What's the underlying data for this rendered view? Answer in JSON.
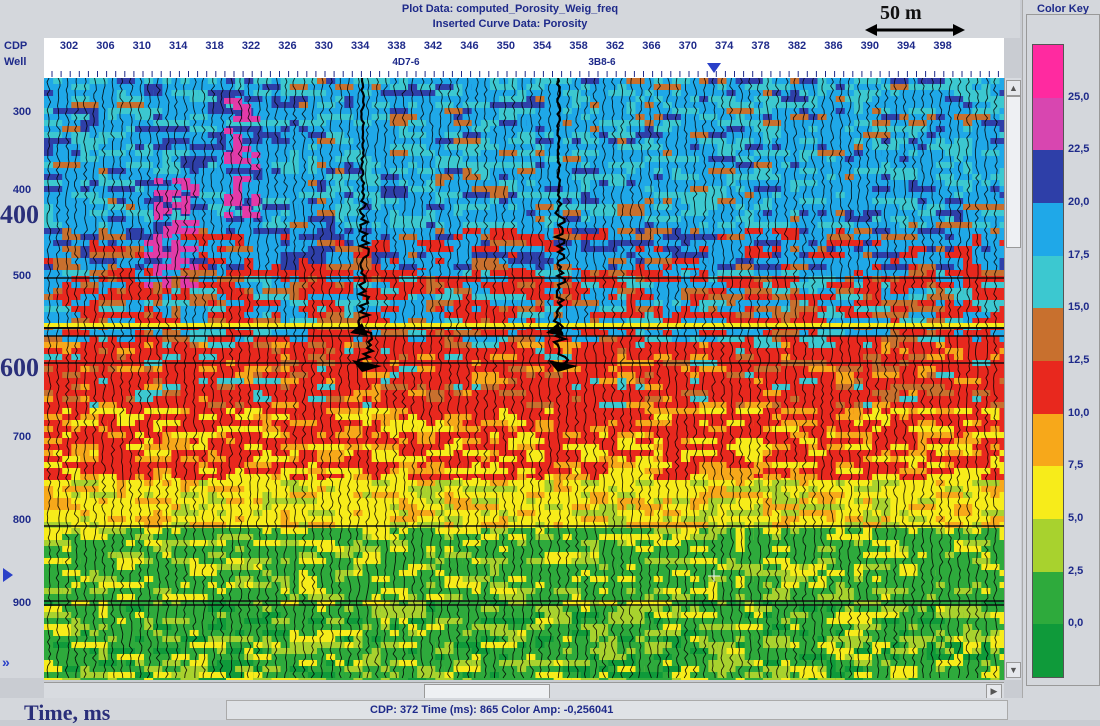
{
  "header": {
    "plot_data": "Plot Data: computed_Porosity_Weig_freq",
    "inserted_curve": "Inserted Curve Data:  Porosity",
    "scale_label": "50 m"
  },
  "axis": {
    "cdp_label": "CDP",
    "well_label": "Well",
    "cdp_ticks": [
      "302",
      "306",
      "310",
      "314",
      "318",
      "322",
      "326",
      "330",
      "334",
      "338",
      "342",
      "346",
      "350",
      "354",
      "358",
      "362",
      "366",
      "370",
      "374",
      "378",
      "382",
      "386",
      "390",
      "394",
      "398"
    ],
    "time_ticks": [
      "300",
      "400",
      "500",
      "700",
      "800",
      "900"
    ],
    "big_time_ticks": [
      "400",
      "600"
    ],
    "title": "Time, ms"
  },
  "wells": [
    {
      "name": "4D7-6"
    },
    {
      "name": "3B8-6"
    }
  ],
  "status": {
    "text": "CDP: 372  Time (ms): 865  Color Amp: -0,256041"
  },
  "color_key": {
    "title": "Color Key",
    "labels": [
      "25,0",
      "22,5",
      "20,0",
      "17,5",
      "15,0",
      "12,5",
      "10,0",
      "7,5",
      "5,0",
      "2,5",
      "0,0"
    ],
    "colors": [
      "#ff2aa0",
      "#d846b0",
      "#2e3fa8",
      "#1fa8e8",
      "#3cc8d0",
      "#c8702e",
      "#e8281e",
      "#f7a81a",
      "#f7ec1a",
      "#a8d22e",
      "#2eaa3c",
      "#0f9a3a"
    ]
  }
}
